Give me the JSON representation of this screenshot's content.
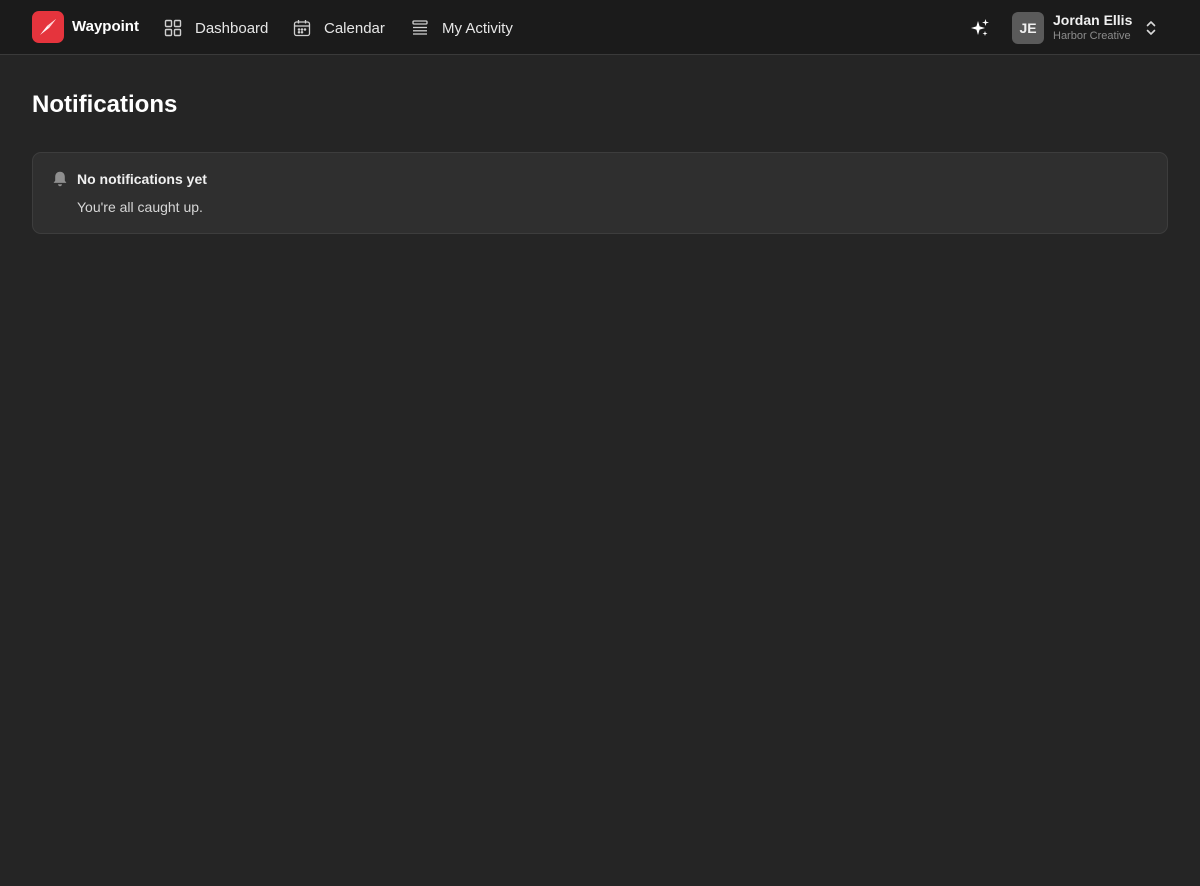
{
  "app": {
    "brand": "Waypoint",
    "logo_color": "#e5343d"
  },
  "nav": {
    "items": [
      {
        "label": "Dashboard",
        "icon": "grid-icon"
      },
      {
        "label": "Calendar",
        "icon": "calendar-icon"
      },
      {
        "label": "My Activity",
        "icon": "list-icon"
      }
    ]
  },
  "header": {
    "ai_icon": "sparkle-icon"
  },
  "user": {
    "initials": "JE",
    "name": "Jordan Ellis",
    "org": "Harbor Creative"
  },
  "page": {
    "title": "Notifications"
  },
  "empty_state": {
    "title": "No notifications yet",
    "message": "You're all caught up.",
    "icon": "bell-icon"
  }
}
